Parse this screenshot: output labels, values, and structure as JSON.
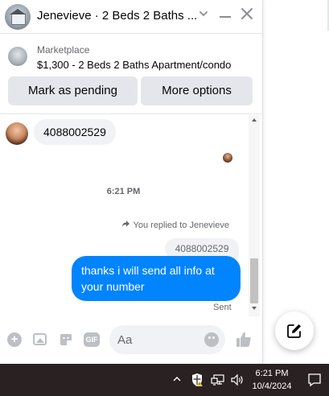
{
  "chat": {
    "title": "Jenevieve · 2 Beds 2 Baths ...",
    "marketplace_label": "Marketplace",
    "listing": "$1,300 - 2 Beds 2 Baths Apartment/condo",
    "mark_pending_label": "Mark as pending",
    "more_options_label": "More options"
  },
  "messages": {
    "incoming_text": "4088002529",
    "timestamp": "6:21 PM",
    "replied_text": "You replied to Jenevieve",
    "quoted_text": "4088002529",
    "outgoing_text": "thanks i will send all info at your number",
    "status": "Sent"
  },
  "composer": {
    "placeholder": "Aa",
    "gif_label": "GIF"
  },
  "taskbar": {
    "time": "6:21 PM",
    "date": "10/4/2024"
  },
  "colors": {
    "accent": "#0084ff",
    "button_bg": "#e4e6eb",
    "taskbar_bg": "#2a2122"
  }
}
